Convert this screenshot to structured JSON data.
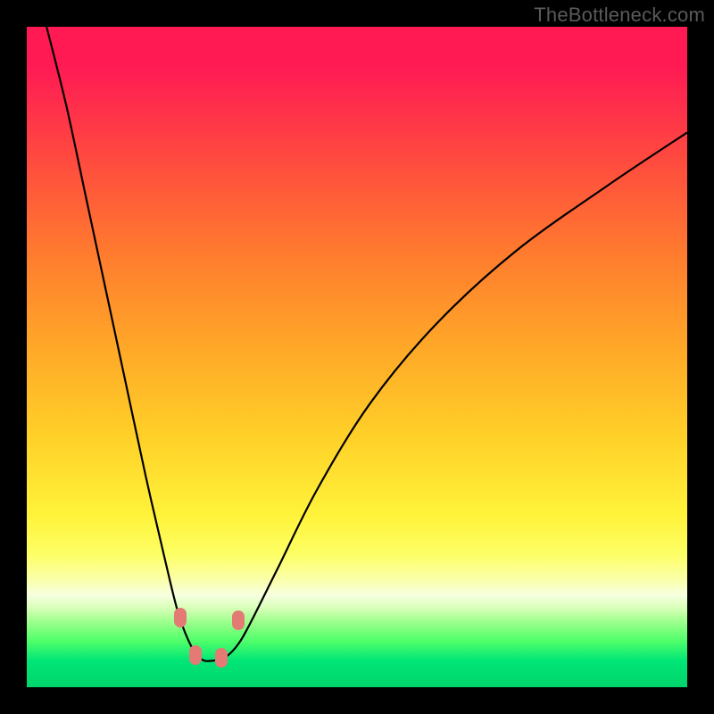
{
  "watermark": "TheBottleneck.com",
  "colors": {
    "frame": "#000000",
    "marker": "#e47a74",
    "curve": "#000000"
  },
  "chart_data": {
    "type": "line",
    "title": "",
    "xlabel": "",
    "ylabel": "",
    "xlim": [
      0,
      100
    ],
    "ylim": [
      0,
      100
    ],
    "series": [
      {
        "name": "bottleneck-curve",
        "x": [
          3,
          6,
          9,
          12,
          15,
          18,
          21,
          23,
          25,
          26.5,
          28,
          30,
          32,
          34,
          38,
          44,
          52,
          62,
          74,
          88,
          100
        ],
        "y": [
          100,
          88,
          74,
          60,
          46,
          32,
          19,
          11,
          6,
          4.2,
          4.0,
          4.5,
          6.5,
          10,
          18,
          30,
          43,
          55,
          66,
          76,
          84
        ]
      }
    ],
    "markers": [
      {
        "x": 23.2,
        "y": 10.5
      },
      {
        "x": 25.5,
        "y": 4.8
      },
      {
        "x": 29.5,
        "y": 4.4
      },
      {
        "x": 32.0,
        "y": 10.2
      }
    ],
    "gradient_stops": [
      {
        "pos": 0.0,
        "color": "#ff1a54"
      },
      {
        "pos": 0.34,
        "color": "#ff7a2f"
      },
      {
        "pos": 0.62,
        "color": "#ffd028"
      },
      {
        "pos": 0.8,
        "color": "#fdff66"
      },
      {
        "pos": 0.9,
        "color": "#9fff8e"
      },
      {
        "pos": 1.0,
        "color": "#00d46c"
      }
    ]
  }
}
